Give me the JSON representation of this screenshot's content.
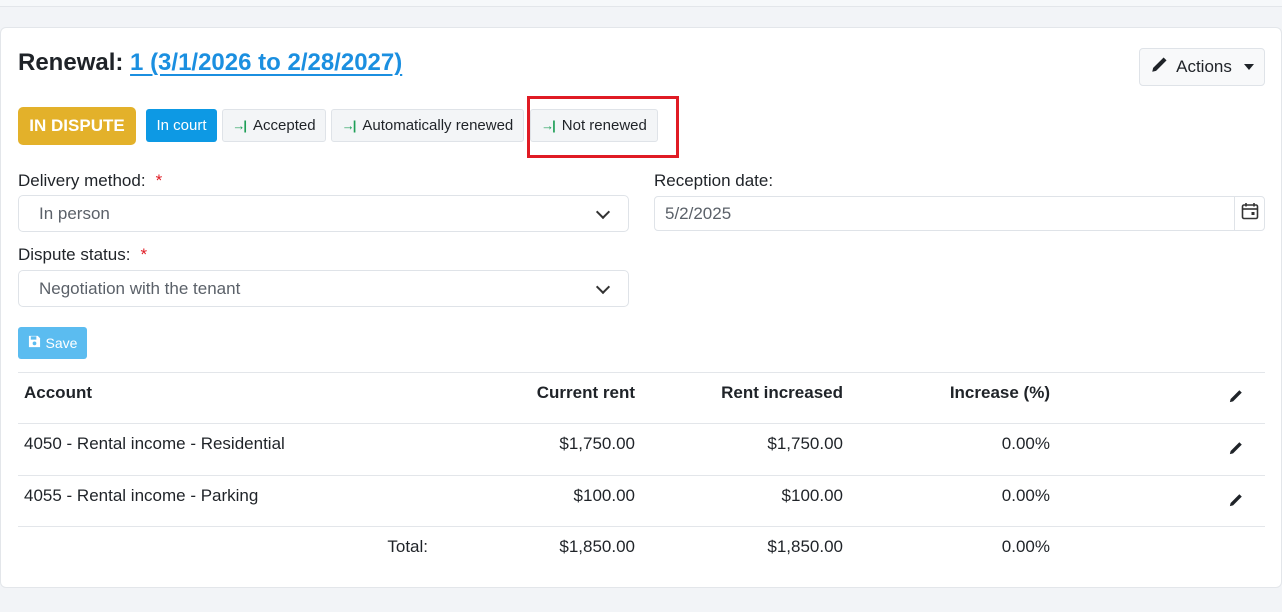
{
  "renewal": {
    "label": "Renewal:",
    "link": "1 (3/1/2026 to 2/28/2027)"
  },
  "actions": {
    "label": "Actions"
  },
  "status": {
    "badge": "IN DISPUTE",
    "in_court": "In court",
    "accepted": "Accepted",
    "auto_renewed": "Automatically renewed",
    "not_renewed": "Not renewed"
  },
  "form": {
    "delivery_label": "Delivery method:",
    "delivery_value": "In person",
    "reception_label": "Reception date:",
    "reception_value": "5/2/2025",
    "dispute_label": "Dispute status:",
    "dispute_value": "Negotiation with the tenant",
    "required_mark": "*",
    "save_label": "Save"
  },
  "table": {
    "headers": [
      "Account",
      "Current rent",
      "Rent increased",
      "Increase (%)"
    ],
    "rows": [
      {
        "account": "4050 - Rental income - Residential",
        "current": "$1,750.00",
        "increased": "$1,750.00",
        "pct": "0.00%"
      },
      {
        "account": "4055 - Rental income - Parking",
        "current": "$100.00",
        "increased": "$100.00",
        "pct": "0.00%"
      }
    ],
    "total": {
      "label": "Total:",
      "current": "$1,850.00",
      "increased": "$1,850.00",
      "pct": "0.00%"
    }
  },
  "colors": {
    "accent": "#1b8fe0",
    "dispute_badge": "#e3b12a",
    "in_court": "#0d99e4",
    "save": "#5bbcf0",
    "highlight": "#e01b24",
    "arrow": "#1e9e57"
  }
}
